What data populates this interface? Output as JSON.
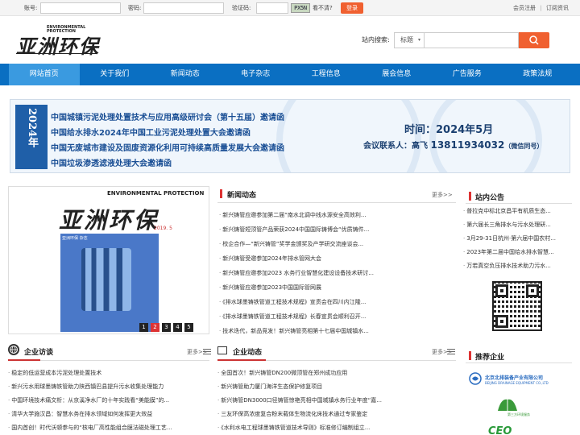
{
  "topbar": {
    "account_label": "账号:",
    "password_label": "密码:",
    "captcha_label": "验证码:",
    "captcha_text": "PX5N",
    "unclear_text": "看不清?",
    "login_button": "登录",
    "register_link": "会员注册",
    "subscribe_link": "订阅资讯",
    "link_separator": "|"
  },
  "header": {
    "logo_cn": "亚洲环保",
    "logo_en_line1": "ENVIRONMENTAL",
    "logo_en_line2": "PROTECTION",
    "search_label": "站内搜索:",
    "search_option": "标题",
    "search_icon": "search-icon"
  },
  "nav": {
    "items": [
      "网站首页",
      "关于我们",
      "新闻动态",
      "电子杂志",
      "工程信息",
      "展会信息",
      "广告服务",
      "政策法规"
    ]
  },
  "banner": {
    "year": "2024年",
    "lines": [
      "中国城镇污泥处理处置技术与应用高级研讨会（第十五届）邀请函",
      "中国给水排水2024年中国工业污泥处理处置大会邀请函",
      "中国无废城市建设及固废资源化利用可持续高质量发展大会邀请函",
      "中国垃圾渗透滤液处理大会邀请函"
    ],
    "time_text": "时间：2024年5月",
    "contact_label": "会议联系人：高飞 ",
    "contact_phone": "13811934032",
    "contact_note": "（微信同号）"
  },
  "magazine": {
    "cn": "亚洲环保",
    "en": "ENVIRONMENTAL PROTECTION",
    "issue": "2019. 5",
    "cover_tag": "亚洲环保 杂志",
    "pages": [
      "1",
      "2",
      "3",
      "4",
      "5"
    ],
    "active_page": "2"
  },
  "news": {
    "title": "新闻动态",
    "more": "更多>>",
    "items": [
      "新兴铸管应邀参加第二届“南水北调中线水源安全高效利...",
      "新兴铸管短顶管产品荣获2024中国国际铸博会“优质铸件...",
      "校企合作—“新兴铸管”奖学金颁奖及产学研交流座谈会...",
      "新兴铸管受邀参加2024年排水管网大会",
      "新兴铸管应邀参加2023 水务行业智慧化建设设备技术研讨...",
      "新兴铸管应邀参加2023中国国际管网展",
      "《排水球墨铸铁管道工程技术规程》宣贯会在四川内江隆...",
      "《排水球墨铸铁管道工程技术规程》长春宣贯会顺利召开...",
      "技术迭代，新品竞发！新兴铸管亮相第十七届中国城镇水..."
    ]
  },
  "notice": {
    "title": "站内公告",
    "items": [
      "普拉克中标北京昌平有机质生态...",
      "第六届长三角排水与污水处理研...",
      "3月29-31日杭州·第六届中国农村...",
      "2023年第二届中国给水排水智慧...",
      "万若真空负压排水技术助力污水..."
    ]
  },
  "interviews": {
    "title": "企业访谈",
    "more": "更多>>",
    "items": [
      "稳定的低运营成本污泥处理处置技术",
      "新兴污水用球墨铸铁管助力陕西镇巴县提升污水收集处理能力",
      "中国环境技术痛文析：从京溪净水厂的十年实践看“美能膜”的...",
      "清华大学施汉昌：智慧水务在排水领域如何发挥更大效益",
      "国内首创！时代沃顿参与的“核电厂高性能组合膜法磁处理工艺..."
    ]
  },
  "company_news": {
    "title": "企业动态",
    "more": "更多>>",
    "items": [
      "全国首次！新兴铸管DN200微顶管在郑州成功应用",
      "新兴铸管助力厦门海洋生态保护修复项目",
      "新兴铸管DN3000口径铸管惊艳亮相中国城镇水务行业年度“嘉...",
      "三友环保高浓度复合粉末载体生物流化床技术通过专家鉴定",
      "《水利水电工程球墨铸铁管道技术导则》标准修订编制组立..."
    ]
  },
  "partners": {
    "title": "推荐企业",
    "items": [
      "北京北排装备产业有限公司",
      "BEIJING DRAINAGE EQUIPMENT CO.,LTD",
      "第三方环境服务",
      "CEO"
    ]
  }
}
